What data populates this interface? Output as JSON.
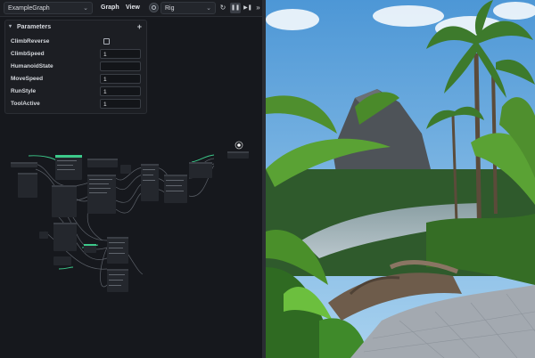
{
  "toolbar": {
    "graph_name": "ExampleGraph",
    "menu": {
      "graph": "Graph",
      "view": "View"
    },
    "rig_select": "Rig",
    "buttons": {
      "refresh": "↻",
      "pause": "❚❚",
      "step": "▶❚",
      "more": "»"
    }
  },
  "parameters": {
    "title": "Parameters",
    "add_label": "+",
    "items": [
      {
        "label": "ClimbReverse",
        "type": "checkbox",
        "checked": false
      },
      {
        "label": "ClimbSpeed",
        "type": "number",
        "value": "1"
      },
      {
        "label": "HumanoidState",
        "type": "text",
        "value": ""
      },
      {
        "label": "MoveSpeed",
        "type": "number",
        "value": "1"
      },
      {
        "label": "RunStyle",
        "type": "number",
        "value": "1"
      },
      {
        "label": "ToolActive",
        "type": "number",
        "value": "1"
      }
    ]
  },
  "colors": {
    "accent_green": "#3cc98a",
    "node_bg": "#2a2d33",
    "wire": "#5b6068"
  },
  "icons": {
    "graph_dropdown": "chevron-down-icon",
    "rig": "target-icon",
    "refresh": "refresh-icon",
    "pause": "pause-icon",
    "step": "step-forward-icon",
    "cursor": "cursor-icon"
  }
}
